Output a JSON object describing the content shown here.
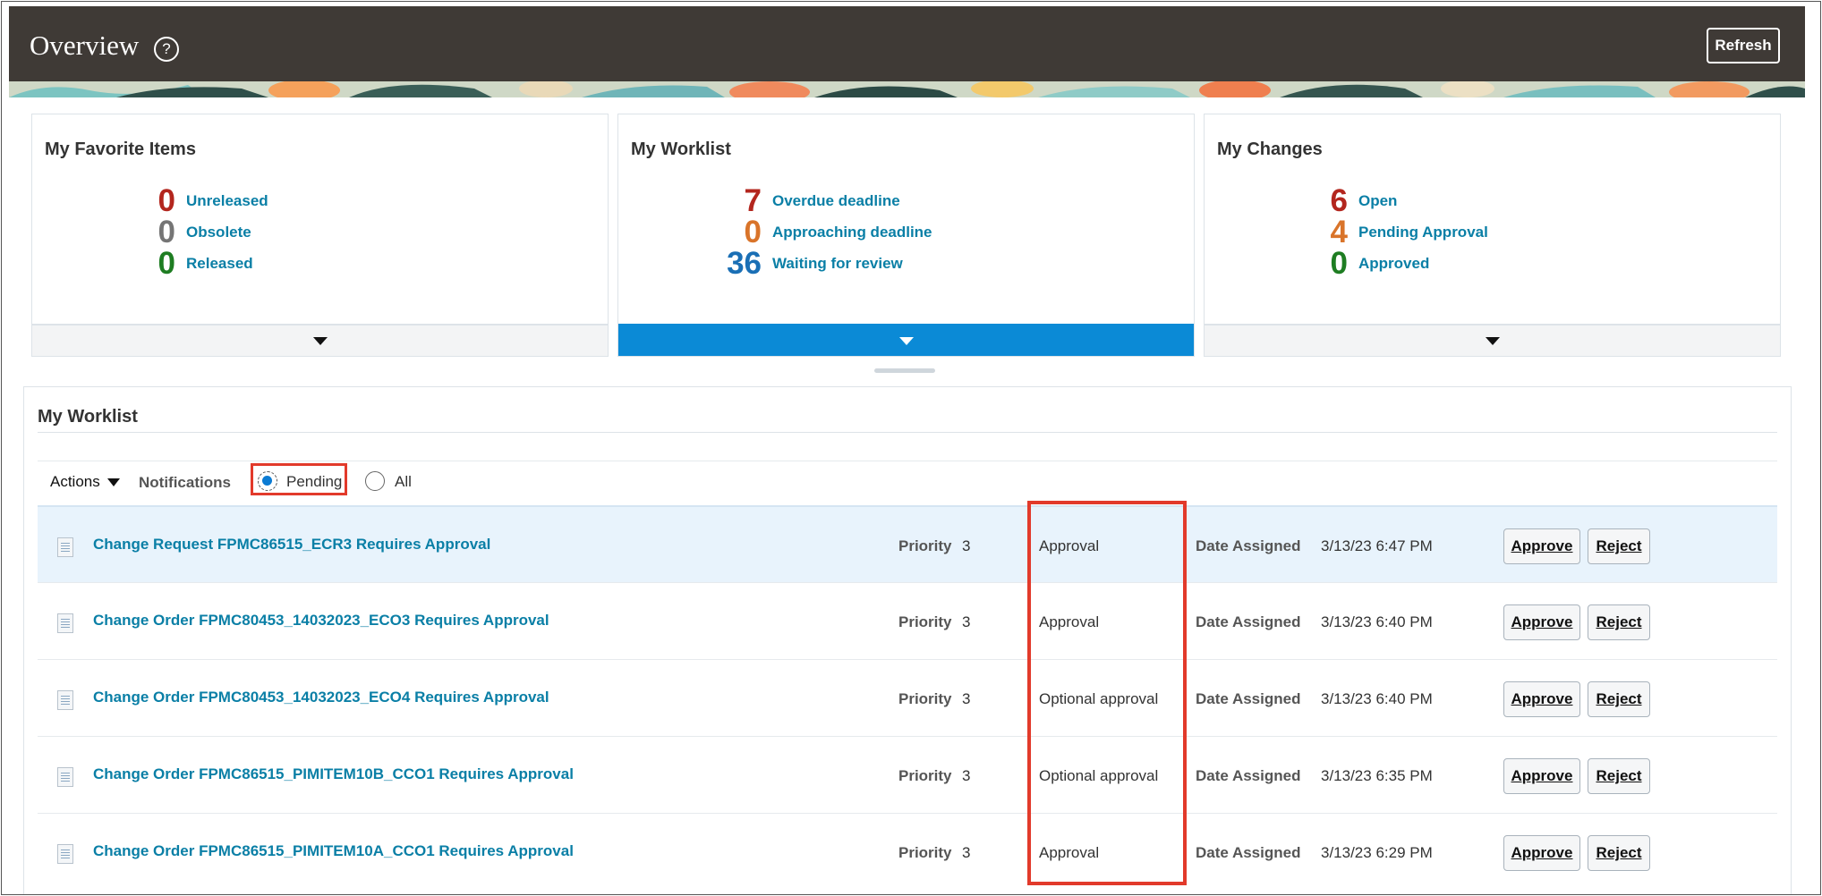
{
  "header": {
    "title": "Overview",
    "help_icon": "?",
    "refresh_label": "Refresh"
  },
  "infolets": {
    "favorites": {
      "title": "My Favorite Items",
      "metrics": [
        {
          "count": "0",
          "label": "Unreleased",
          "color": "#b3261e"
        },
        {
          "count": "0",
          "label": "Obsolete",
          "color": "#757575"
        },
        {
          "count": "0",
          "label": "Released",
          "color": "#1e7d22"
        }
      ]
    },
    "worklist": {
      "title": "My Worklist",
      "metrics": [
        {
          "count": "7",
          "label": "Overdue deadline",
          "color": "#b3261e"
        },
        {
          "count": "0",
          "label": "Approaching deadline",
          "color": "#d9742a"
        },
        {
          "count": "36",
          "label": "Waiting for review",
          "color": "#1a6fb5"
        }
      ]
    },
    "changes": {
      "title": "My Changes",
      "metrics": [
        {
          "count": "6",
          "label": "Open",
          "color": "#b3261e"
        },
        {
          "count": "4",
          "label": "Pending Approval",
          "color": "#d9742a"
        },
        {
          "count": "0",
          "label": "Approved",
          "color": "#1e7d22"
        }
      ]
    }
  },
  "worklist": {
    "title": "My Worklist",
    "actions_label": "Actions",
    "notifications_label": "Notifications",
    "filter_options": [
      {
        "label": "Pending",
        "checked": true
      },
      {
        "label": "All",
        "checked": false
      }
    ],
    "rows": [
      {
        "title": "Change Request FPMC86515_ECR3 Requires Approval",
        "priority_label": "Priority",
        "priority": "3",
        "type": "Approval",
        "date_label": "Date Assigned",
        "date": "3/13/23 6:47 PM",
        "approve": "Approve",
        "reject": "Reject"
      },
      {
        "title": "Change Order FPMC80453_14032023_ECO3 Requires Approval",
        "priority_label": "Priority",
        "priority": "3",
        "type": "Approval",
        "date_label": "Date Assigned",
        "date": "3/13/23 6:40 PM",
        "approve": "Approve",
        "reject": "Reject"
      },
      {
        "title": "Change Order FPMC80453_14032023_ECO4 Requires Approval",
        "priority_label": "Priority",
        "priority": "3",
        "type": "Optional approval",
        "date_label": "Date Assigned",
        "date": "3/13/23 6:40 PM",
        "approve": "Approve",
        "reject": "Reject"
      },
      {
        "title": "Change Order FPMC86515_PIMITEM10B_CCO1 Requires Approval",
        "priority_label": "Priority",
        "priority": "3",
        "type": "Optional approval",
        "date_label": "Date Assigned",
        "date": "3/13/23 6:35 PM",
        "approve": "Approve",
        "reject": "Reject"
      },
      {
        "title": "Change Order FPMC86515_PIMITEM10A_CCO1 Requires Approval",
        "priority_label": "Priority",
        "priority": "3",
        "type": "Approval",
        "date_label": "Date Assigned",
        "date": "3/13/23 6:29 PM",
        "approve": "Approve",
        "reject": "Reject"
      }
    ]
  },
  "colors": {
    "header_bg": "#3f3a36",
    "link": "#0a7fa6",
    "active_infolet": "#0b8ad6",
    "highlight_annotation": "#e23a2b"
  },
  "icons": [
    "help-icon",
    "caret-down-icon",
    "document-icon",
    "radio-button"
  ]
}
